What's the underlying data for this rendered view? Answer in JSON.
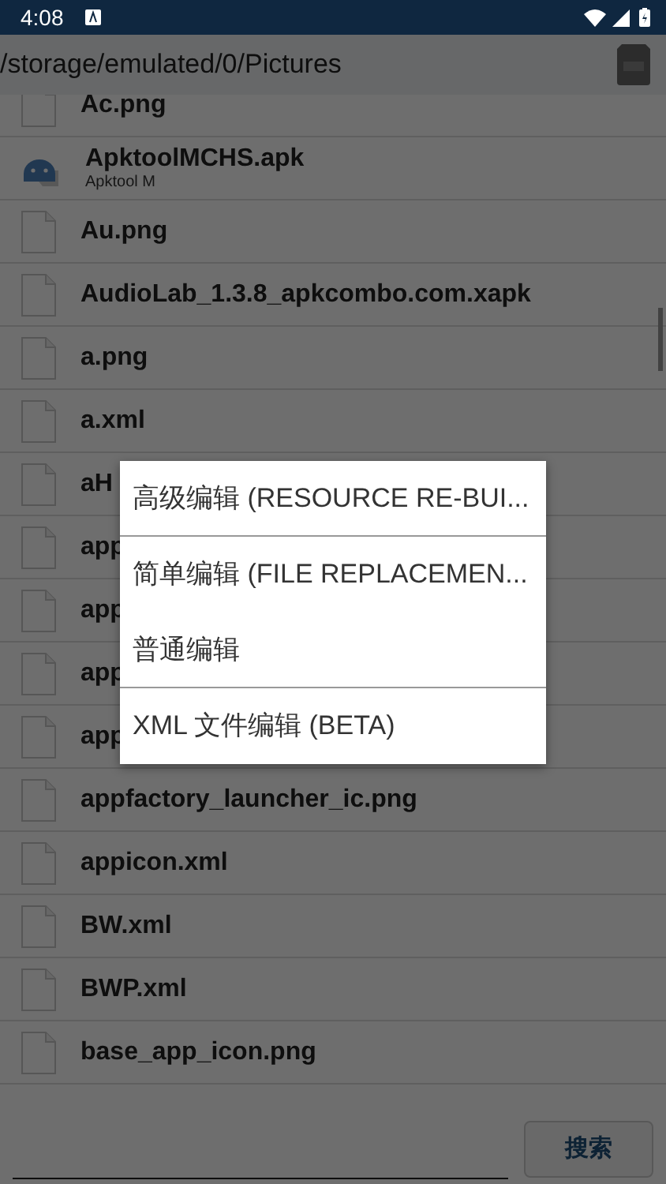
{
  "status_bar": {
    "time": "4:08"
  },
  "path_bar": {
    "path": "/storage/emulated/0/Pictures"
  },
  "files": [
    {
      "kind": "file",
      "name": "Ac.png"
    },
    {
      "kind": "apk",
      "name": "ApktoolMCHS.apk",
      "subtitle": "Apktool M"
    },
    {
      "kind": "file",
      "name": "Au.png"
    },
    {
      "kind": "file",
      "name": "AudioLab_1.3.8_apkcombo.com.xapk"
    },
    {
      "kind": "file",
      "name": "a.png"
    },
    {
      "kind": "file",
      "name": "a.xml"
    },
    {
      "kind": "file",
      "name": "aH"
    },
    {
      "kind": "file",
      "name": "app"
    },
    {
      "kind": "file",
      "name": "app"
    },
    {
      "kind": "file",
      "name": "app"
    },
    {
      "kind": "file",
      "name": "app"
    },
    {
      "kind": "file",
      "name": "appfactory_launcher_ic.png"
    },
    {
      "kind": "file",
      "name": "appicon.xml"
    },
    {
      "kind": "file",
      "name": "BW.xml"
    },
    {
      "kind": "file",
      "name": "BWP.xml"
    },
    {
      "kind": "file",
      "name": "base_app_icon.png"
    }
  ],
  "menu": {
    "items": [
      {
        "label": "高级编辑 (RESOURCE RE-BUI...",
        "divider_after": true
      },
      {
        "label": "简单编辑 (FILE REPLACEMEN...",
        "divider_after": false
      },
      {
        "label": "普通编辑",
        "divider_after": true
      },
      {
        "label": "XML 文件编辑 (BETA)",
        "divider_after": false
      }
    ]
  },
  "search": {
    "button": "搜索"
  }
}
